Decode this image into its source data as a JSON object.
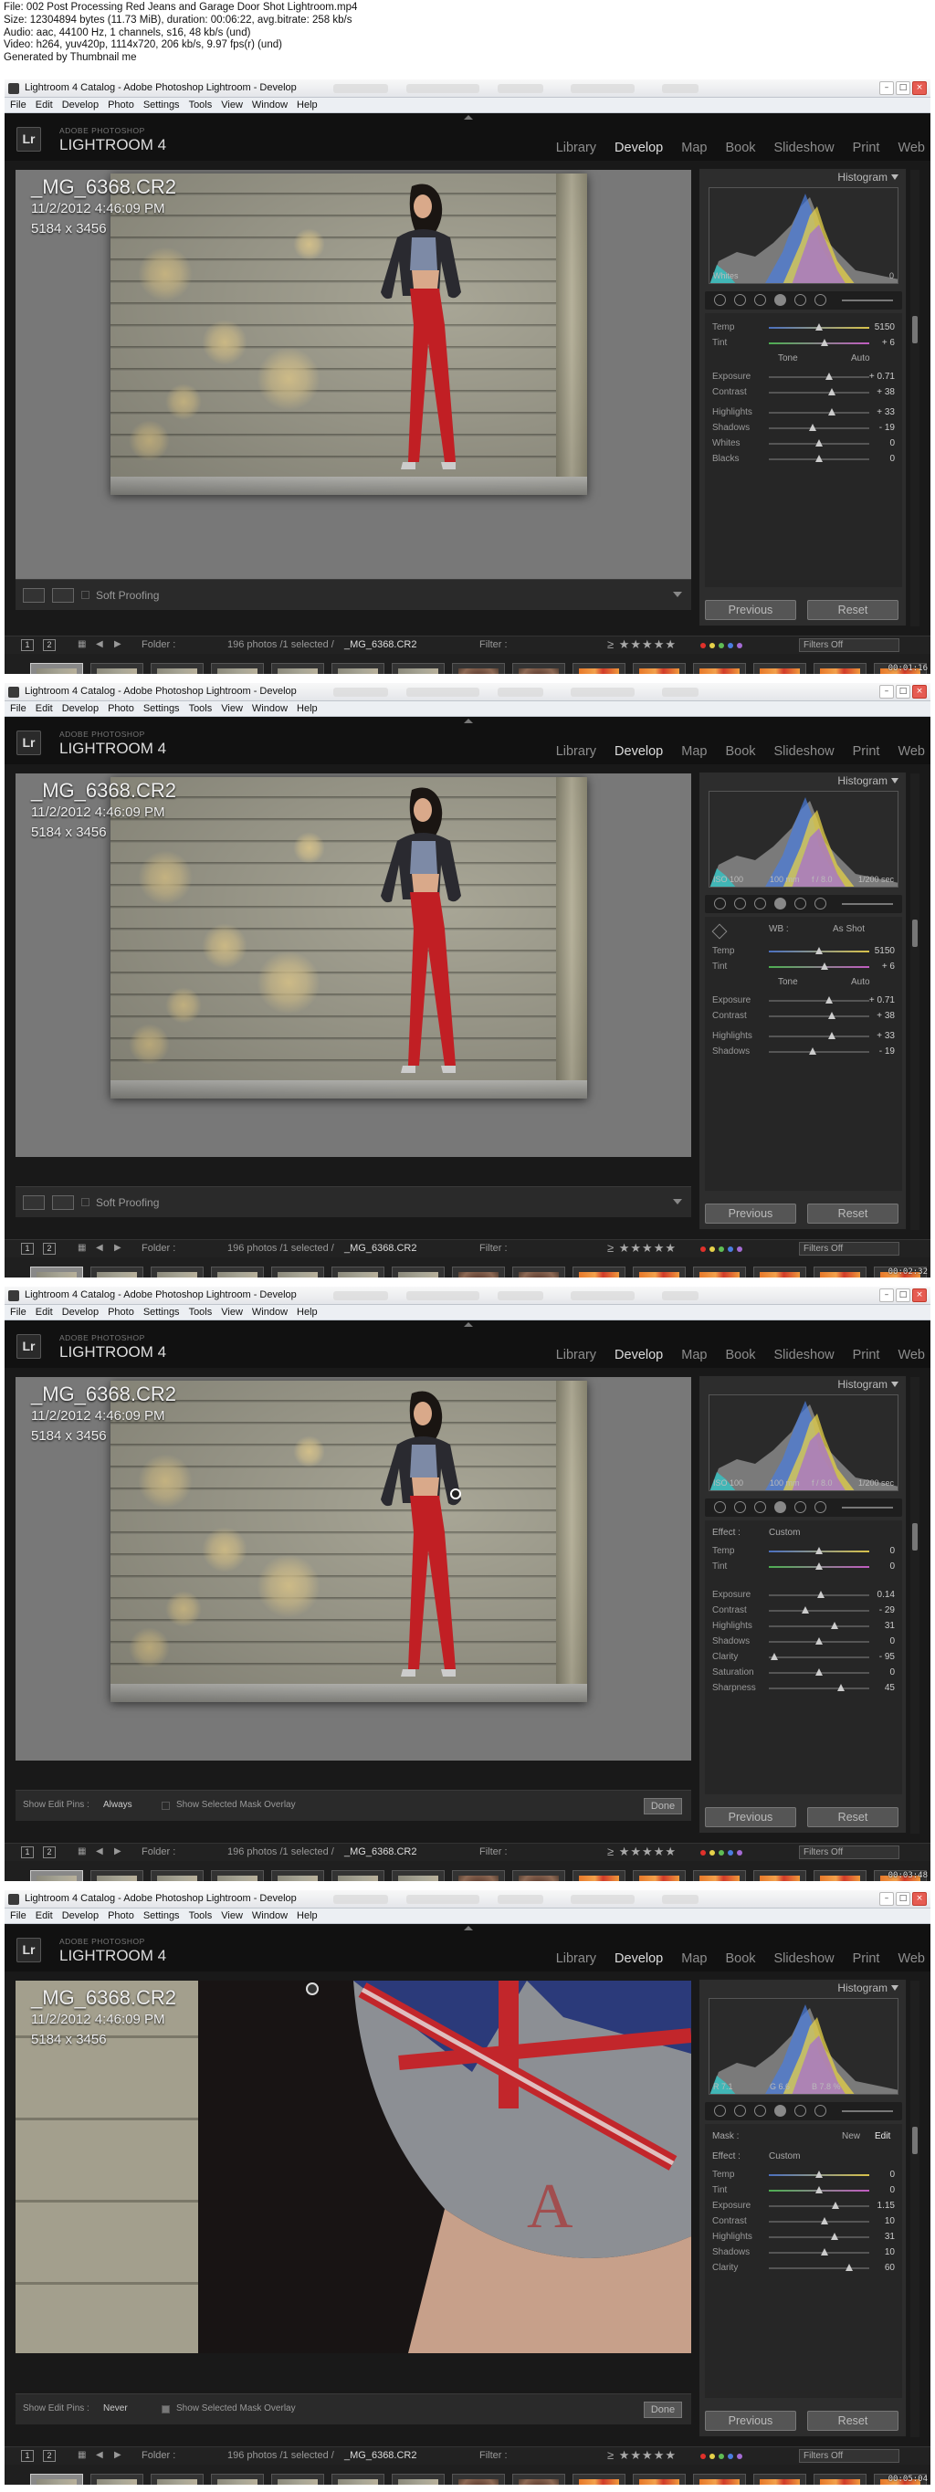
{
  "meta": {
    "lines": [
      "File: 002 Post Processing Red Jeans and Garage Door Shot Lightroom.mp4",
      "Size: 12304894 bytes (11.73 MiB), duration: 00:06:22, avg.bitrate: 258 kb/s",
      "Audio: aac, 44100 Hz, 1 channels, s16, 48 kb/s (und)",
      "Video: h264, yuv420p, 1114x720, 206 kb/s, 9.97 fps(r) (und)",
      "Generated by Thumbnail me"
    ]
  },
  "app": {
    "menu": [
      "File",
      "Edit",
      "Develop",
      "Photo",
      "Settings",
      "Tools",
      "View",
      "Window",
      "Help"
    ],
    "brand_small": "ADOBE PHOTOSHOP",
    "brand": "LIGHTROOM 4",
    "logo": "Lr",
    "modules": [
      "Library",
      "Develop",
      "Map",
      "Book",
      "Slideshow",
      "Print",
      "Web"
    ],
    "active_module": "Develop"
  },
  "photo_info": {
    "filename": "_MG_6368.CR2",
    "datetime": "11/2/2012 4:46:09 PM",
    "dimensions": "5184 x 3456"
  },
  "panel": {
    "title": "Histogram",
    "previous": "Previous",
    "reset": "Reset"
  },
  "filmstrip_bar": {
    "page1": "1",
    "page2": "2",
    "folder": "Folder :",
    "count": "196 photos /1 selected /",
    "selected": "_MG_6368.CR2",
    "filter_label": "Filter :",
    "filters_off": "Filters Off"
  },
  "colors": {
    "red": "#e0312b",
    "yellow": "#e6d14a",
    "green": "#5fbd55",
    "blue": "#4a7de0",
    "purple": "#a46bd4"
  },
  "frames": [
    {
      "title": "Lightroom 4 Catalog - Adobe Photoshop Lightroom - Develop",
      "timecode": "00:01:16",
      "view": "photo",
      "toolbar_label": "Soft Proofing",
      "hist_label_left": "Whites",
      "hist_label_right": "0",
      "section1": "Tone",
      "section2": "Auto",
      "sliders": [
        {
          "label": "Temp",
          "value": "5150",
          "pos": 0.5
        },
        {
          "label": "Tint",
          "value": "+ 6",
          "pos": 0.55
        },
        {
          "label": "Exposure",
          "value": "+ 0.71",
          "pos": 0.6
        },
        {
          "label": "Contrast",
          "value": "+ 38",
          "pos": 0.63
        },
        {
          "label": "Highlights",
          "value": "+ 33",
          "pos": 0.63
        },
        {
          "label": "Shadows",
          "value": "- 19",
          "pos": 0.44
        },
        {
          "label": "Whites",
          "value": "0",
          "pos": 0.5
        },
        {
          "label": "Blacks",
          "value": "0",
          "pos": 0.5
        }
      ]
    },
    {
      "title": "Lightroom 4 Catalog - Adobe Photoshop Lightroom - Develop",
      "timecode": "00:02:32",
      "view": "photo",
      "toolbar_label": "Soft Proofing",
      "hist_label_left": "ISO 100",
      "hist_label_mid": "100 mm",
      "hist_label_mid2": "f / 8.0",
      "hist_label_right": "1/200 sec",
      "wb_label": "WB :",
      "wb_value": "As Shot",
      "section1": "Tone",
      "section2": "Auto",
      "sliders": [
        {
          "label": "Temp",
          "value": "5150",
          "pos": 0.5
        },
        {
          "label": "Tint",
          "value": "+ 6",
          "pos": 0.55
        },
        {
          "label": "Exposure",
          "value": "+ 0.71",
          "pos": 0.6
        },
        {
          "label": "Contrast",
          "value": "+ 38",
          "pos": 0.63
        },
        {
          "label": "Highlights",
          "value": "+ 33",
          "pos": 0.63
        },
        {
          "label": "Shadows",
          "value": "- 19",
          "pos": 0.44
        }
      ]
    },
    {
      "title": "Lightroom 4 Catalog - Adobe Photoshop Lightroom - Develop",
      "timecode": "00:03:48",
      "view": "photo",
      "edit_pins_label": "Show Edit Pins :",
      "edit_pins_value": "Always",
      "overlay_label": "Show Selected Mask Overlay",
      "done": "Done",
      "hist_label_left": "ISO 100",
      "hist_label_mid": "100 mm",
      "hist_label_mid2": "f / 8.0",
      "hist_label_right": "1/200 sec",
      "effect_label": "Effect :",
      "effect_value": "Custom",
      "sliders": [
        {
          "label": "Temp",
          "value": "0",
          "pos": 0.5
        },
        {
          "label": "Tint",
          "value": "0",
          "pos": 0.5
        },
        {
          "label": "Exposure",
          "value": "0.14",
          "pos": 0.52
        },
        {
          "label": "Contrast",
          "value": "- 29",
          "pos": 0.36
        },
        {
          "label": "Highlights",
          "value": "31",
          "pos": 0.65
        },
        {
          "label": "Shadows",
          "value": "0",
          "pos": 0.5
        },
        {
          "label": "Clarity",
          "value": "- 95",
          "pos": 0.05
        },
        {
          "label": "Saturation",
          "value": "0",
          "pos": 0.5
        },
        {
          "label": "Sharpness",
          "value": "45",
          "pos": 0.72
        }
      ]
    },
    {
      "title": "Lightroom 4 Catalog - Adobe Photoshop Lightroom - Develop",
      "timecode": "00:05:04",
      "view": "zoom",
      "edit_pins_label": "Show Edit Pins :",
      "edit_pins_value": "Never",
      "overlay_label": "Show Selected Mask Overlay",
      "done": "Done",
      "hist_label_left": "R 7.1",
      "hist_label_mid": "G 6.6",
      "hist_label_mid2": "B 7.8 %",
      "hist_label_right": "",
      "mask_label": "Mask :",
      "mask_new": "New",
      "mask_edit": "Edit",
      "effect_label": "Effect :",
      "effect_value": "Custom",
      "sliders": [
        {
          "label": "Temp",
          "value": "0",
          "pos": 0.5
        },
        {
          "label": "Tint",
          "value": "0",
          "pos": 0.5
        },
        {
          "label": "Exposure",
          "value": "1.15",
          "pos": 0.66
        },
        {
          "label": "Contrast",
          "value": "10",
          "pos": 0.55
        },
        {
          "label": "Highlights",
          "value": "31",
          "pos": 0.65
        },
        {
          "label": "Shadows",
          "value": "10",
          "pos": 0.55
        },
        {
          "label": "Clarity",
          "value": "60",
          "pos": 0.8
        }
      ]
    }
  ]
}
